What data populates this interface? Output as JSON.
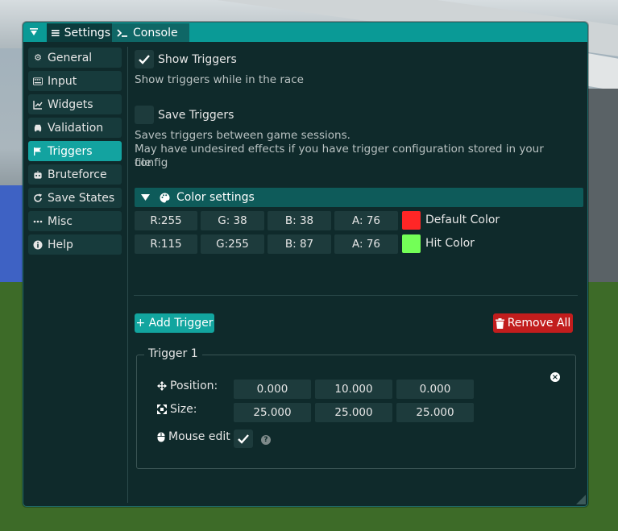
{
  "tabs": [
    {
      "label": "Settings",
      "icon": "list-icon"
    },
    {
      "label": "Console",
      "icon": "terminal-icon"
    }
  ],
  "sidebar": {
    "items": [
      {
        "label": "General",
        "icon": "gear-icon"
      },
      {
        "label": "Input",
        "icon": "keyboard-icon"
      },
      {
        "label": "Widgets",
        "icon": "chart-line-icon"
      },
      {
        "label": "Validation",
        "icon": "car-icon"
      },
      {
        "label": "Triggers",
        "icon": "flag-icon",
        "active": true
      },
      {
        "label": "Bruteforce",
        "icon": "robot-icon"
      },
      {
        "label": "Save States",
        "icon": "redo-icon"
      },
      {
        "label": "Misc",
        "icon": "ellipsis-icon"
      },
      {
        "label": "Help",
        "icon": "info-icon"
      }
    ]
  },
  "options": {
    "show_triggers": {
      "label": "Show Triggers",
      "checked": true,
      "description": "Show triggers while in the race"
    },
    "save_triggers": {
      "label": "Save Triggers",
      "checked": false,
      "description_line1": "Saves triggers between game sessions.",
      "description_line2": "May have undesired effects if you have trigger configuration stored in your config",
      "description_line3": "file"
    }
  },
  "color_settings": {
    "header": "Color settings",
    "rows": [
      {
        "r": "R:255",
        "g": "G: 38",
        "b": "B: 38",
        "a": "A: 76",
        "label": "Default Color",
        "swatch": "#ff2626"
      },
      {
        "r": "R:115",
        "g": "G:255",
        "b": "B: 87",
        "a": "A: 76",
        "label": "Hit Color",
        "swatch": "#73ff57"
      }
    ]
  },
  "actions": {
    "add_trigger": "+ Add Trigger",
    "remove_all": "Remove All"
  },
  "trigger": {
    "title": "Trigger 1",
    "position_label": "Position:",
    "position": [
      "0.000",
      "10.000",
      "0.000"
    ],
    "size_label": "Size:",
    "size": [
      "25.000",
      "25.000",
      "25.000"
    ],
    "mouse_edit_label": "Mouse edit",
    "mouse_edit_checked": true,
    "help_glyph": "?"
  },
  "colors": {
    "accent": "#13a3a0",
    "tabbar": "#0a9a96",
    "window_bg": "#0f2a2b",
    "danger": "#c21d1d"
  }
}
